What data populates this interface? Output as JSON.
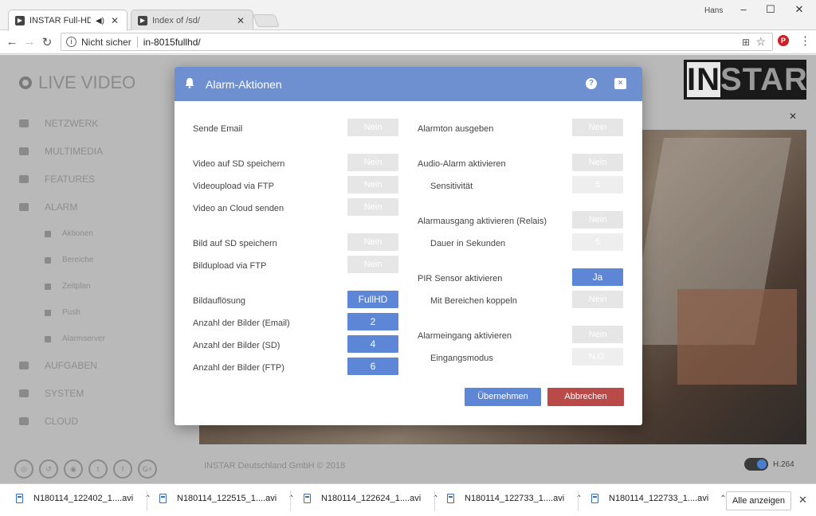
{
  "browser": {
    "tabs": [
      {
        "label": "INSTAR Full-HD IP-Ca",
        "active": true,
        "speaker": "◀)"
      },
      {
        "label": "Index of /sd/",
        "active": false
      }
    ],
    "user": "Hans",
    "address": {
      "security": "Nicht sicher",
      "url": "in-8015fullhd/"
    }
  },
  "sidebar": {
    "live_video": "LIVE VIDEO",
    "items": [
      {
        "label": "NETZWERK"
      },
      {
        "label": "MULTIMEDIA"
      },
      {
        "label": "FEATURES"
      },
      {
        "label": "ALARM"
      }
    ],
    "alarm_subitems": [
      {
        "label": "Aktionen"
      },
      {
        "label": "Bereiche"
      },
      {
        "label": "Zeitplan"
      },
      {
        "label": "Push"
      },
      {
        "label": "Alarmserver"
      }
    ],
    "items_bottom": [
      {
        "label": "AUFGABEN"
      },
      {
        "label": "SYSTEM"
      },
      {
        "label": "CLOUD"
      }
    ]
  },
  "page": {
    "logo_hl": "IN",
    "logo_rest": "STAR",
    "footer": "INSTAR Deutschland GmbH © 2018",
    "codec": "H.264"
  },
  "modal": {
    "title": "Alarm-Aktionen",
    "help_icon": "?",
    "close_icon": "×",
    "left": [
      {
        "label": "Sende Email",
        "value": "Nein",
        "on": false
      },
      {
        "label": "Video auf SD speichern",
        "value": "Nein",
        "on": false
      },
      {
        "label": "Videoupload via FTP",
        "value": "Nein",
        "on": false
      },
      {
        "label": "Video an Cloud senden",
        "value": "Nein",
        "on": false
      },
      {
        "label": "Bild auf SD speichern",
        "value": "Nein",
        "on": false
      },
      {
        "label": "Bildupload via FTP",
        "value": "Nein",
        "on": false
      },
      {
        "label": "Bildauflösung",
        "value": "FullHD",
        "on": true
      },
      {
        "label": "Anzahl der Bilder (Email)",
        "value": "2",
        "on": true
      },
      {
        "label": "Anzahl der Bilder (SD)",
        "value": "4",
        "on": true
      },
      {
        "label": "Anzahl der Bilder (FTP)",
        "value": "6",
        "on": true
      }
    ],
    "right": [
      {
        "label": "Alarmton ausgeben",
        "value": "Nein",
        "on": false
      },
      {
        "label": "Audio-Alarm aktivieren",
        "value": "Nein",
        "on": false
      },
      {
        "label": "Sensitivität",
        "value": "5",
        "on": false
      },
      {
        "label": "Alarmausgang aktivieren (Relais)",
        "value": "Nein",
        "on": false
      },
      {
        "label": "Dauer in Sekunden",
        "value": "5",
        "on": false
      },
      {
        "label": "PIR Sensor aktivieren",
        "value": "Ja",
        "on": true
      },
      {
        "label": "Mit Bereichen koppeln",
        "value": "Nein",
        "on": false
      },
      {
        "label": "Alarmeingang aktivieren",
        "value": "Nein",
        "on": false
      },
      {
        "label": "Eingangsmodus",
        "value": "N.O.",
        "on": false
      }
    ],
    "apply_label": "Übernehmen",
    "cancel_label": "Abbrechen"
  },
  "downloads": {
    "files": [
      "N180114_122402_1....avi",
      "N180114_122515_1....avi",
      "N180114_122624_1....avi",
      "N180114_122733_1....avi",
      "N180114_122733_1....avi"
    ],
    "show_all": "Alle anzeigen"
  },
  "colors": {
    "accent": "#5e86d6",
    "header": "#6e8fd0",
    "danger": "#b94a48"
  }
}
